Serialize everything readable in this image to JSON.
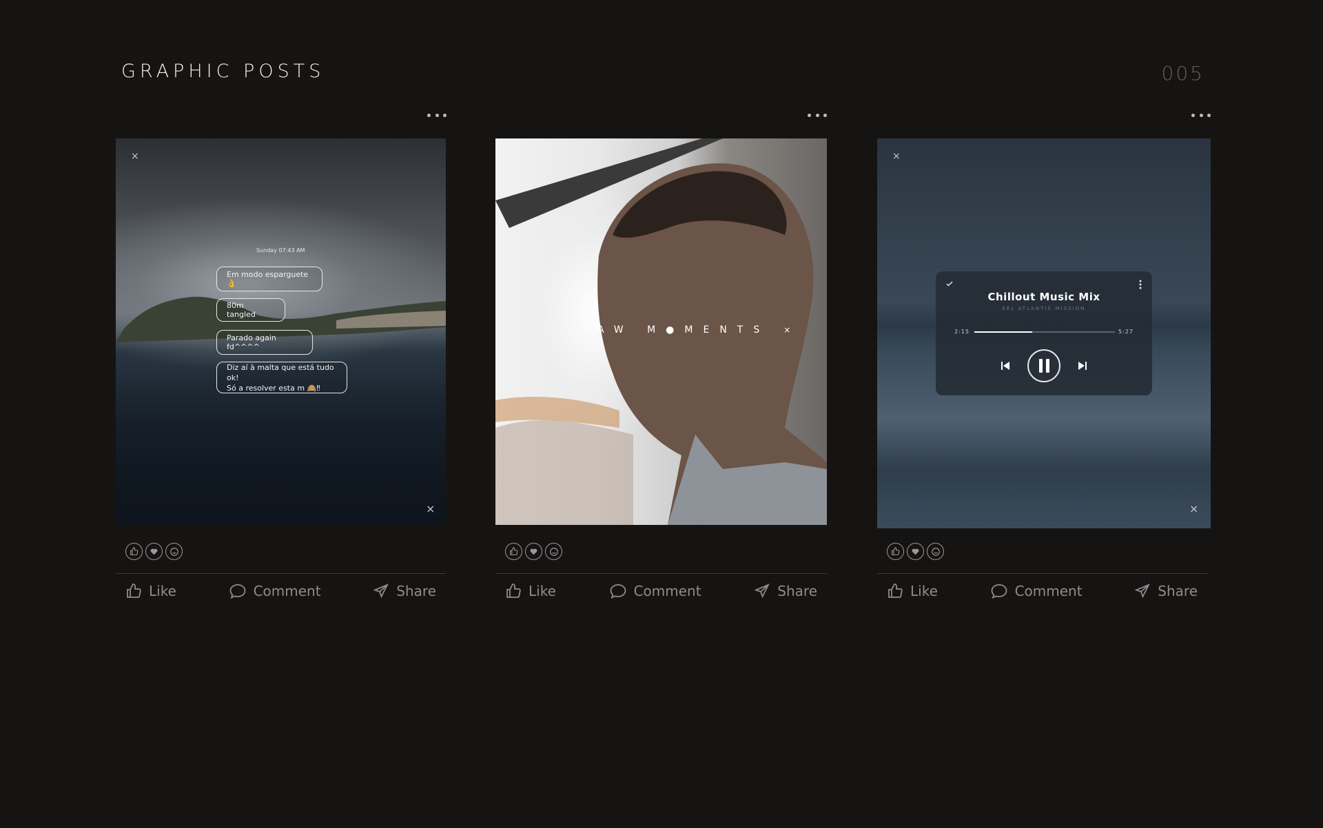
{
  "header": {
    "title": "GRAPHIC POSTS",
    "page_number": "005"
  },
  "actions": {
    "like": "Like",
    "comment": "Comment",
    "share": "Share"
  },
  "posts": [
    {
      "chat": {
        "timestamp": "Sunday 07:43 AM",
        "bubbles": [
          "Em modo esparguete 👌",
          "80m tangled",
          "Parado again fd^^^^",
          "Diz aí à malta que está tudo ok!",
          "Só a resolver esta m 🙈‼"
        ]
      }
    },
    {
      "overlay_text": "AW M●MENTS",
      "overlay_close": "×"
    },
    {
      "player": {
        "title": "Chillout Music Mix",
        "subtitle": "EEL ATLANTIC MISSION",
        "elapsed": "2:15",
        "duration": "5:27",
        "progress": 0.41
      }
    }
  ]
}
